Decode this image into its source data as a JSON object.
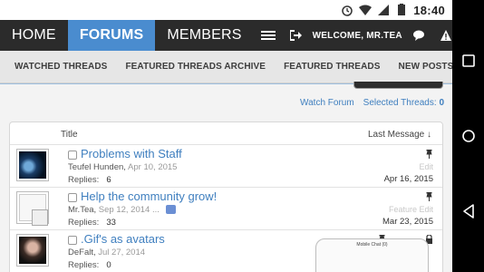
{
  "statusbar": {
    "icons": [
      "alarm-icon",
      "wifi-icon",
      "signal-icon",
      "battery-icon"
    ],
    "time": "18:40"
  },
  "topnav": {
    "home": "HOME",
    "forums": "FORUMS",
    "members": "MEMBERS",
    "welcome": "WELCOME,",
    "username": "MR.TEA",
    "icons": [
      "menu-icon",
      "logout-icon",
      "chat-icon",
      "alert-icon"
    ]
  },
  "subnav": {
    "items": [
      "WATCHED THREADS",
      "FEATURED THREADS ARCHIVE",
      "FEATURED THREADS",
      "NEW POSTS",
      "..."
    ]
  },
  "actions": {
    "watch_forum": "Watch Forum",
    "selected_threads": "Selected Threads:",
    "selected_count": "0"
  },
  "list": {
    "col_title": "Title",
    "col_last": "Last Message ↓",
    "threads": [
      {
        "title": "Problems with Staff",
        "author": "Teufel Hunden",
        "date": "Apr 10, 2015",
        "replies_label": "Replies:",
        "replies": "6",
        "edit_label": "Edit",
        "last_date": "Apr 16, 2015"
      },
      {
        "title": "Help the community grow!",
        "author": "Mr.Tea",
        "date": "Sep 12, 2014",
        "ellipsis": "...",
        "replies_label": "Replies:",
        "replies": "33",
        "edit_label": "Feature Edit",
        "last_date": "Mar 23, 2015"
      },
      {
        "title": ".Gif's as avatars",
        "author": "DeFalt",
        "date": "Jul 27, 2014",
        "replies_label": "Replies:",
        "replies": "0"
      }
    ]
  },
  "chat": {
    "title": "Mobile Chat (0)"
  },
  "colors": {
    "accent": "#4a8ccf",
    "link": "#3f7fbf",
    "topbar": "#2b2b2b"
  }
}
